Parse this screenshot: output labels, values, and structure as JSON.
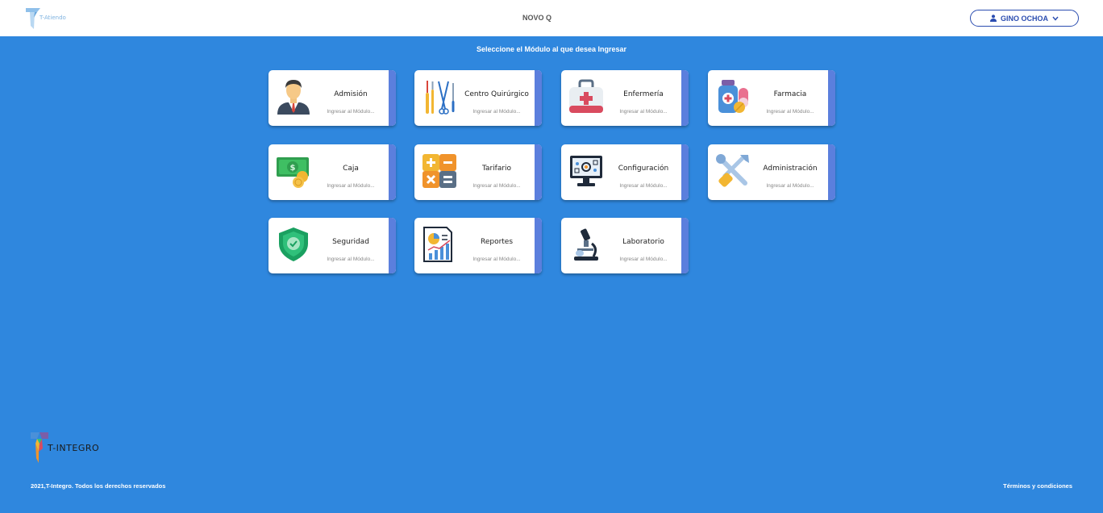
{
  "header": {
    "logo_text": "T-Atiendo",
    "app_title": "NOVO Q",
    "user_name": "GINO OCHOA"
  },
  "main": {
    "instruction": "Seleccione el Módulo al que desea Ingresar"
  },
  "modules": [
    {
      "title": "Admisión",
      "subtitle": "Ingresar al Módulo...",
      "icon": "businessman-icon"
    },
    {
      "title": "Centro Quirúrgico",
      "subtitle": "Ingresar al Módulo...",
      "icon": "surgical-tools-icon"
    },
    {
      "title": "Enfermería",
      "subtitle": "Ingresar al Módulo...",
      "icon": "first-aid-kit-icon"
    },
    {
      "title": "Farmacia",
      "subtitle": "Ingresar al Módulo...",
      "icon": "medicine-icon"
    },
    {
      "title": "Caja",
      "subtitle": "Ingresar al Módulo...",
      "icon": "money-icon"
    },
    {
      "title": "Tarifario",
      "subtitle": "Ingresar al Módulo...",
      "icon": "calculator-icon"
    },
    {
      "title": "Configuración",
      "subtitle": "Ingresar al Módulo...",
      "icon": "computer-settings-icon"
    },
    {
      "title": "Administración",
      "subtitle": "Ingresar al Módulo...",
      "icon": "tools-icon"
    },
    {
      "title": "Seguridad",
      "subtitle": "Ingresar al Módulo...",
      "icon": "shield-icon"
    },
    {
      "title": "Reportes",
      "subtitle": "Ingresar al Módulo...",
      "icon": "report-icon"
    },
    {
      "title": "Laboratorio",
      "subtitle": "Ingresar al Módulo...",
      "icon": "microscope-icon"
    }
  ],
  "footer": {
    "brand": "T-INTEGRO",
    "copyright": "2021,T-Integro. Todos los derechos reservados",
    "terms": "Términos y condiciones"
  },
  "colors": {
    "background": "#2f87de",
    "card_stripe": "#5b7fdd",
    "user_button": "#2b4db0"
  }
}
